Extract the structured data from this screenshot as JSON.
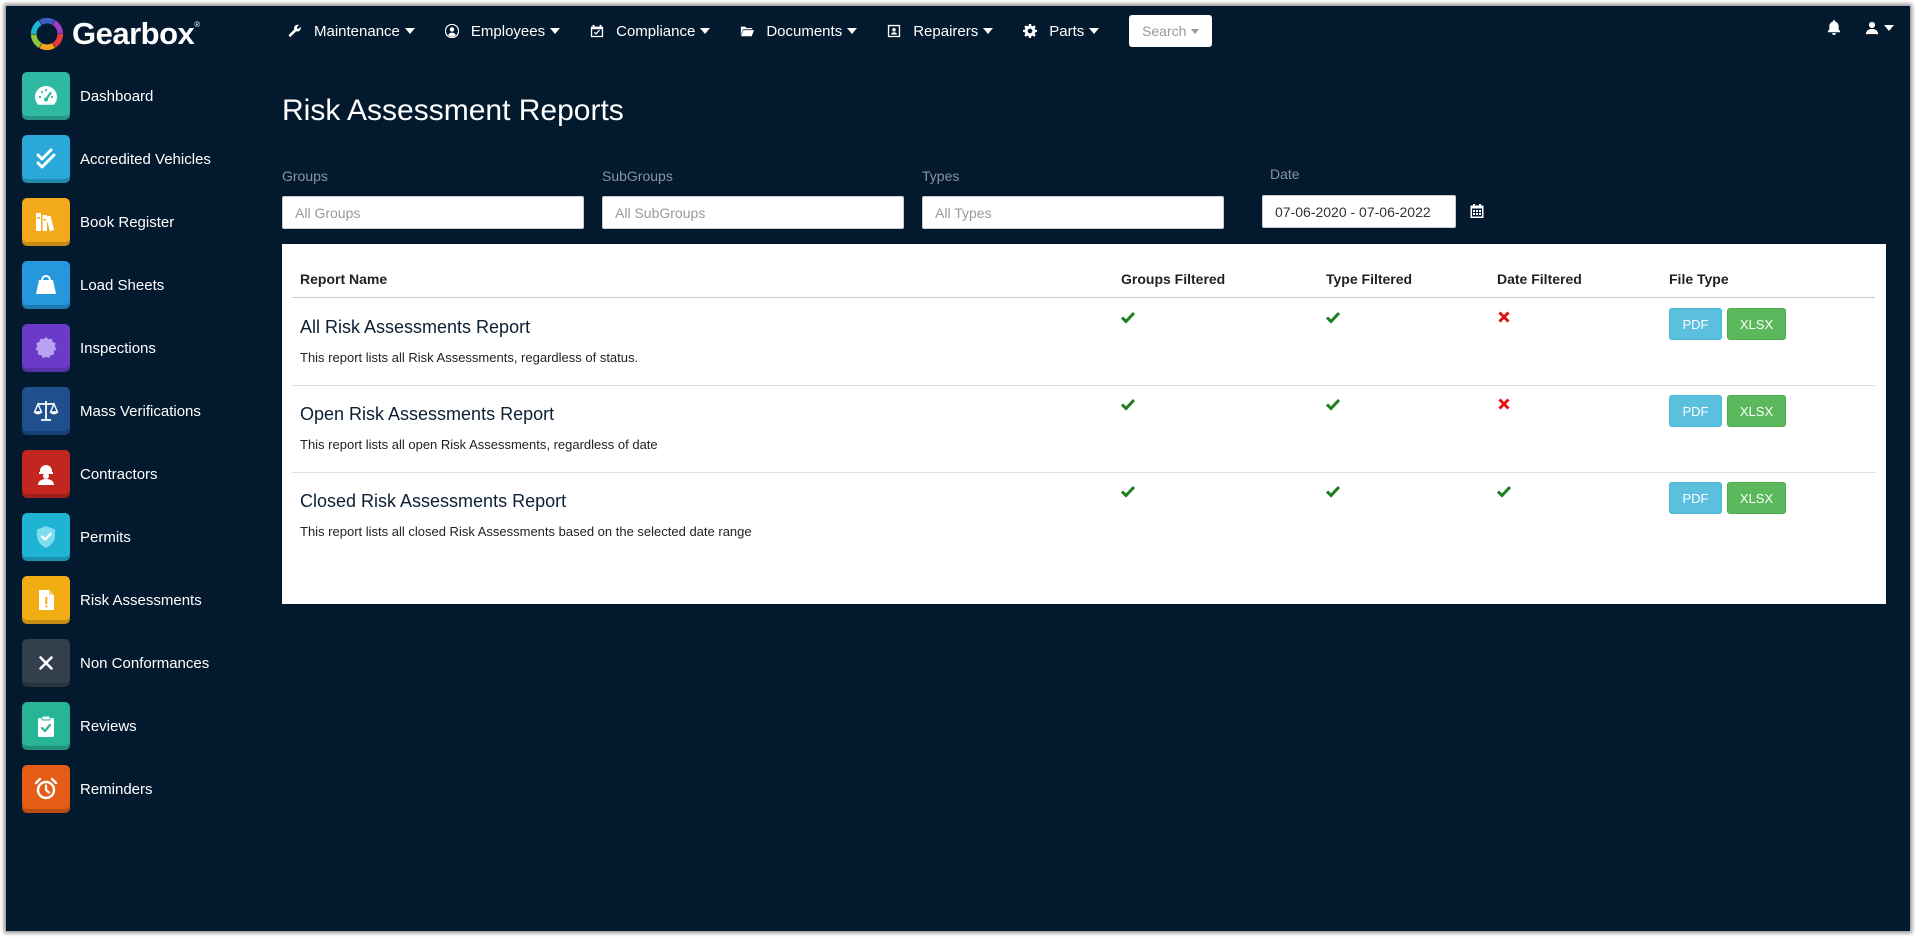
{
  "app": {
    "name": "Gearbox",
    "trademark": "®"
  },
  "topnav": {
    "items": [
      {
        "label": "Maintenance",
        "icon": "wrench-icon"
      },
      {
        "label": "Employees",
        "icon": "user-circle-icon"
      },
      {
        "label": "Compliance",
        "icon": "calendar-check-icon"
      },
      {
        "label": "Documents",
        "icon": "folder-open-icon"
      },
      {
        "label": "Repairers",
        "icon": "id-card-icon"
      },
      {
        "label": "Parts",
        "icon": "gear-icon"
      }
    ],
    "search_label": "Search"
  },
  "sidebar": {
    "items": [
      {
        "label": "Dashboard",
        "icon": "speedometer-icon",
        "color": "#2fb8a2"
      },
      {
        "label": "Accredited Vehicles",
        "icon": "double-check-icon",
        "color": "#2aa8d8"
      },
      {
        "label": "Book Register",
        "icon": "books-icon",
        "color": "#f2a91c"
      },
      {
        "label": "Load Sheets",
        "icon": "weight-bag-icon",
        "color": "#2597da"
      },
      {
        "label": "Inspections",
        "icon": "badge-icon",
        "color": "#6a3bc8"
      },
      {
        "label": "Mass Verifications",
        "icon": "scales-icon",
        "color": "#1f4f8c"
      },
      {
        "label": "Contractors",
        "icon": "worker-icon",
        "color": "#c2261f"
      },
      {
        "label": "Permits",
        "icon": "shield-check-icon",
        "color": "#1fb4d4"
      },
      {
        "label": "Risk Assessments",
        "icon": "warning-file-icon",
        "color": "#f2ac14"
      },
      {
        "label": "Non Conformances",
        "icon": "x-icon",
        "color": "#333f4d"
      },
      {
        "label": "Reviews",
        "icon": "clipboard-check-icon",
        "color": "#26b596"
      },
      {
        "label": "Reminders",
        "icon": "alarm-clock-icon",
        "color": "#e35d17"
      }
    ]
  },
  "page": {
    "title": "Risk Assessment Reports"
  },
  "filters": {
    "groups_label": "Groups",
    "groups_placeholder": "All Groups",
    "subgroups_label": "SubGroups",
    "subgroups_placeholder": "All SubGroups",
    "types_label": "Types",
    "types_placeholder": "All Types",
    "date_label": "Date",
    "date_value": "07-06-2020 - 07-06-2022"
  },
  "table": {
    "headers": {
      "name": "Report Name",
      "groups": "Groups Filtered",
      "type": "Type Filtered",
      "date": "Date Filtered",
      "file": "File Type"
    },
    "rows": [
      {
        "name": "All Risk Assessments Report",
        "description": "This report lists all Risk Assessments, regardless of status.",
        "groups_filtered": true,
        "type_filtered": true,
        "date_filtered": false,
        "pdf_label": "PDF",
        "xlsx_label": "XLSX"
      },
      {
        "name": "Open Risk Assessments Report",
        "description": "This report lists all open Risk Assessments, regardless of date",
        "groups_filtered": true,
        "type_filtered": true,
        "date_filtered": false,
        "pdf_label": "PDF",
        "xlsx_label": "XLSX"
      },
      {
        "name": "Closed Risk Assessments Report",
        "description": "This report lists all closed Risk Assessments based on the selected date range",
        "groups_filtered": true,
        "type_filtered": true,
        "date_filtered": true,
        "pdf_label": "PDF",
        "xlsx_label": "XLSX"
      }
    ]
  },
  "colors": {
    "background": "#03192e",
    "check": "#1e7e1e",
    "cross": "#e01010",
    "pdf": "#5bc0de",
    "xlsx": "#5cb85c"
  }
}
